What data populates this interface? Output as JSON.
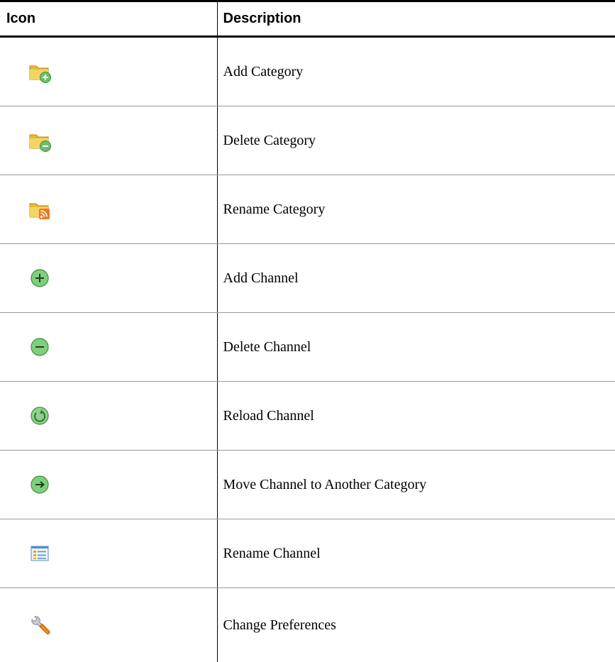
{
  "table": {
    "headers": {
      "icon": "Icon",
      "description": "Description"
    },
    "rows": [
      {
        "icon": "folder-add-icon",
        "description": "Add Category"
      },
      {
        "icon": "folder-delete-icon",
        "description": "Delete Category"
      },
      {
        "icon": "folder-rss-icon",
        "description": "Rename Category"
      },
      {
        "icon": "plus-circle-icon",
        "description": "Add Channel"
      },
      {
        "icon": "minus-circle-icon",
        "description": "Delete Channel"
      },
      {
        "icon": "reload-icon",
        "description": "Reload Channel"
      },
      {
        "icon": "arrow-right-circle-icon",
        "description": "Move Channel to Another Category"
      },
      {
        "icon": "list-window-icon",
        "description": "Rename Channel"
      },
      {
        "icon": "wrench-icon",
        "description": "Change Preferences"
      }
    ]
  },
  "colors": {
    "folder": "#e8b935",
    "green": "#6cbf6a",
    "rss": "#f07a1e",
    "wrench_handle": "#f08a1a",
    "rule": "#000000"
  }
}
